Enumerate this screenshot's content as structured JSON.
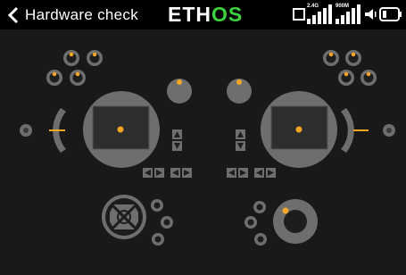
{
  "header": {
    "title": "Hardware check",
    "logo_left": "ETH",
    "logo_right": "OS",
    "rf_band_1": "2.4G",
    "rf_band_2": "900M"
  },
  "icons": {
    "back": "chevron-left-icon",
    "screenshot": "screenshot-icon",
    "signal_24": "signal-bars-icon",
    "signal_900": "signal-bars-icon",
    "volume": "speaker-icon",
    "battery": "battery-icon"
  },
  "colors": {
    "header_bg": "#000000",
    "screen_bg": "#191919",
    "accent": "#f5a623",
    "logo_green": "#3fd23f",
    "control_fill": "#6e6e6e",
    "stick_pad": "#2e2e2e"
  }
}
